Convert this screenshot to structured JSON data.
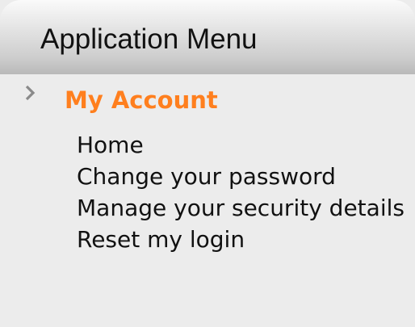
{
  "menu": {
    "title": "Application Menu",
    "section": {
      "icon": "chevron-right-icon",
      "title": "My Account",
      "title_color": "#ff7f1e"
    },
    "items": [
      {
        "label": "Home"
      },
      {
        "label": "Change your password"
      },
      {
        "label": "Manage your security details"
      },
      {
        "label": "Reset my login"
      }
    ]
  }
}
